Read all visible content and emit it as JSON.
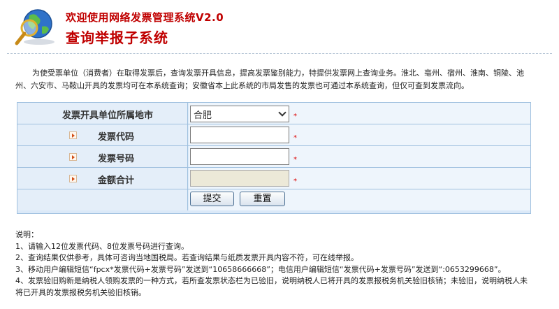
{
  "header": {
    "title": "欢迎使用网络发票管理系统V2.0",
    "subtitle": "查询举报子系统"
  },
  "intro": "为使受票单位（消费者）在取得发票后，查询发票开具信息，提高发票鉴别能力，特提供发票网上查询业务。淮北、亳州、宿州、淮南、铜陵、池州、六安市、马鞍山开具的发票均可在本系统查询；安徽省本上此系统的市局发售的发票也可通过本系统查询，但仅可查到发票流向。",
  "form": {
    "city_label": "发票开具单位所属地市",
    "city_value": "合肥",
    "code_label": "发票代码",
    "number_label": "发票号码",
    "amount_label": "金额合计",
    "required_mark": "*",
    "code_value": "",
    "number_value": "",
    "amount_value": "",
    "submit_label": "提交",
    "reset_label": "重置"
  },
  "notes": {
    "title": "说明：",
    "items": [
      "1、请输入12位发票代码、8位发票号码进行查询。",
      "2、查询结果仅供参考，具体可咨询当地国税局。若查询结果与纸质发票开具内容不符，可在线举报。",
      "3、移动用户编辑短信“fpcx*发票代码+发票号码”发送到“10658666668”；电信用户编辑短信“发票代码+发票号码”发送到“:0653299668”。",
      "4、发票验旧购新是纳税人领购发票的一种方式，若所查发票状态栏为已验旧，说明纳税人已将开具的发票报税务机关验旧核销；未验旧，说明纳税人未将已开具的发票报税务机关验旧核销。"
    ]
  },
  "colors": {
    "title_red": "#c00000",
    "table_bg": "#dbe9f8",
    "border": "#9fc0df"
  }
}
